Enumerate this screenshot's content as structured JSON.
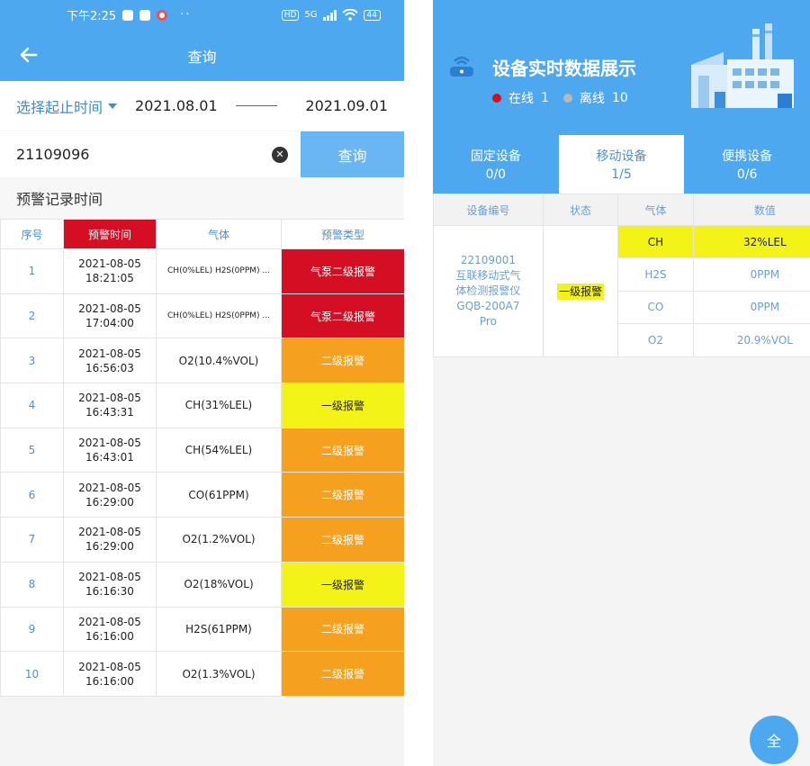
{
  "left": {
    "status_bar": {
      "time": "下午2:25",
      "network": "5G",
      "battery": "44"
    },
    "header": {
      "title": "查询"
    },
    "date_range": {
      "picker_label": "选择起止时间",
      "start": "2021.08.01",
      "end": "2021.09.01"
    },
    "search": {
      "value": "21109096",
      "button_label": "查询"
    },
    "section_title": "预警记录时间",
    "table": {
      "headers": [
        "序号",
        "预警时间",
        "气体",
        "预警类型"
      ],
      "rows": [
        {
          "index": "1",
          "date": "2021-08-05",
          "time": "18:21:05",
          "gas": "CH(0%LEL) H2S(0PPM) ...",
          "type": "气泵二级报警",
          "level": "lv2a"
        },
        {
          "index": "2",
          "date": "2021-08-05",
          "time": "17:04:00",
          "gas": "CH(0%LEL) H2S(0PPM) ...",
          "type": "气泵二级报警",
          "level": "lv2a"
        },
        {
          "index": "3",
          "date": "2021-08-05",
          "time": "16:56:03",
          "gas": "O2(10.4%VOL)",
          "type": "二级报警",
          "level": "lv2"
        },
        {
          "index": "4",
          "date": "2021-08-05",
          "time": "16:43:31",
          "gas": "CH(31%LEL)",
          "type": "一级报警",
          "level": "lv1"
        },
        {
          "index": "5",
          "date": "2021-08-05",
          "time": "16:43:01",
          "gas": "CH(54%LEL)",
          "type": "二级报警",
          "level": "lv2"
        },
        {
          "index": "6",
          "date": "2021-08-05",
          "time": "16:29:00",
          "gas": "CO(61PPM)",
          "type": "二级报警",
          "level": "lv2"
        },
        {
          "index": "7",
          "date": "2021-08-05",
          "time": "16:29:00",
          "gas": "O2(1.2%VOL)",
          "type": "二级报警",
          "level": "lv2"
        },
        {
          "index": "8",
          "date": "2021-08-05",
          "time": "16:16:30",
          "gas": "O2(18%VOL)",
          "type": "一级报警",
          "level": "lv1"
        },
        {
          "index": "9",
          "date": "2021-08-05",
          "time": "16:16:00",
          "gas": "H2S(61PPM)",
          "type": "二级报警",
          "level": "lv2"
        },
        {
          "index": "10",
          "date": "2021-08-05",
          "time": "16:16:00",
          "gas": "O2(1.3%VOL)",
          "type": "二级报警",
          "level": "lv2"
        }
      ]
    },
    "colors": {
      "primary": "#4ea8f0",
      "level2_pump": "#d40f23",
      "level2": "#f5a11f",
      "level1": "#f3f318"
    }
  },
  "right": {
    "title": "设备实时数据展示",
    "online_label": "在线",
    "online_count": "1",
    "offline_label": "离线",
    "offline_count": "10",
    "tabs": [
      {
        "name": "固定设备",
        "count": "0/0"
      },
      {
        "name": "移动设备",
        "count": "1/5"
      },
      {
        "name": "便携设备",
        "count": "0/6"
      }
    ],
    "table": {
      "headers": [
        "设备编号",
        "状态",
        "气体",
        "数值"
      ],
      "device": {
        "line1": "22109001",
        "line2": "互联移动式气",
        "line3": "体检测报警仪",
        "line4": "GQB-200A7",
        "line5": "Pro"
      },
      "status": "一级报警",
      "readings": [
        {
          "gas": "CH",
          "value": "32%LEL"
        },
        {
          "gas": "H2S",
          "value": "0PPM"
        },
        {
          "gas": "CO",
          "value": "0PPM"
        },
        {
          "gas": "O2",
          "value": "20.9%VOL"
        }
      ]
    },
    "fab_label": "全",
    "colors": {
      "online": "#d40f23",
      "offline": "#b8b8b8"
    }
  }
}
